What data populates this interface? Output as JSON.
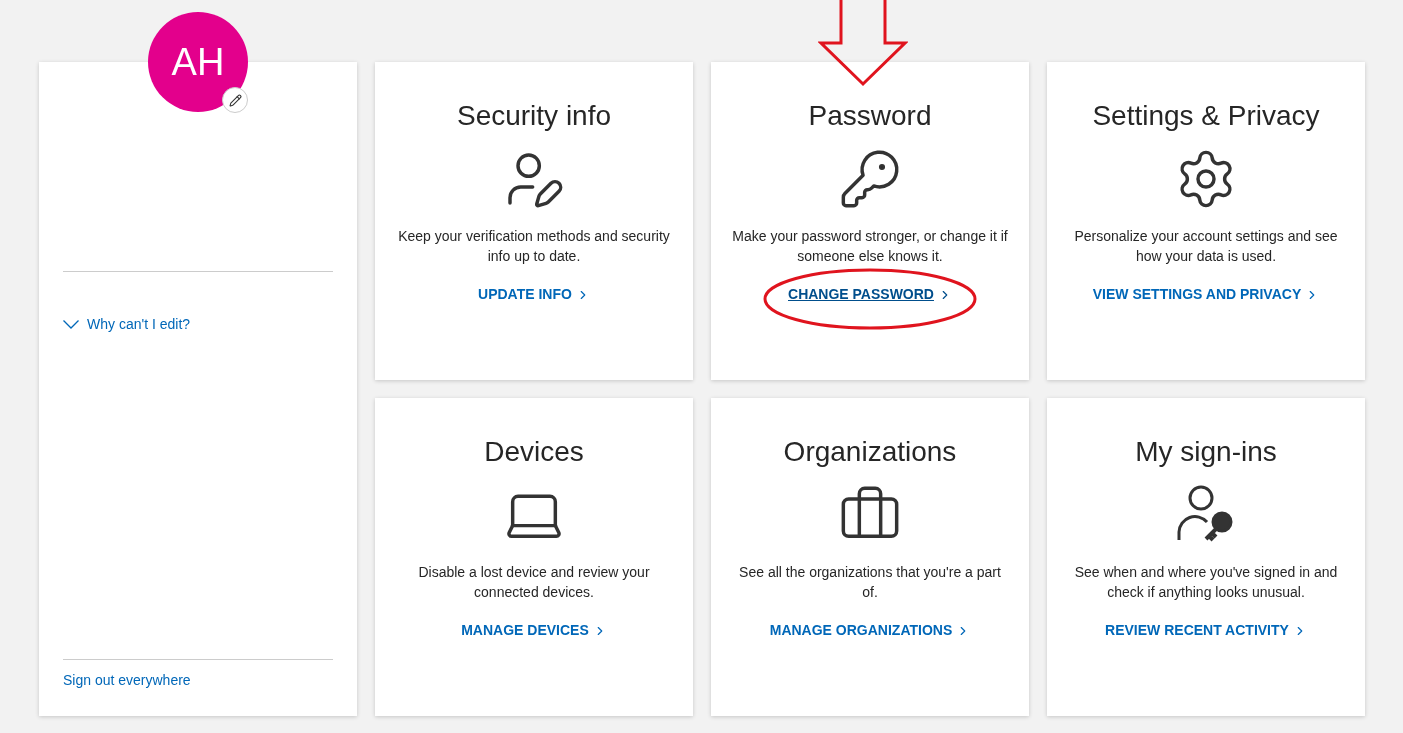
{
  "profile": {
    "initials": "AH",
    "why_link": "Why can't I edit?",
    "sign_out": "Sign out everywhere"
  },
  "tiles": [
    {
      "kind": "security",
      "title": "Security info",
      "description": "Keep your verification methods and security info up to date.",
      "link": "UPDATE INFO",
      "focused": false
    },
    {
      "kind": "password",
      "title": "Password",
      "description": "Make your password stronger, or change it if someone else knows it.",
      "link": "CHANGE PASSWORD",
      "focused": true
    },
    {
      "kind": "settings",
      "title": "Settings & Privacy",
      "description": "Personalize your account settings and see how your data is used.",
      "link": "VIEW SETTINGS AND PRIVACY",
      "focused": false
    },
    {
      "kind": "devices",
      "title": "Devices",
      "description": "Disable a lost device and review your connected devices.",
      "link": "MANAGE DEVICES",
      "focused": false
    },
    {
      "kind": "organizations",
      "title": "Organizations",
      "description": "See all the organizations that you're a part of.",
      "link": "MANAGE ORGANIZATIONS",
      "focused": false
    },
    {
      "kind": "signins",
      "title": "My sign-ins",
      "description": "See when and where you've signed in and check if anything looks unusual.",
      "link": "REVIEW RECENT ACTIVITY",
      "focused": false
    }
  ]
}
